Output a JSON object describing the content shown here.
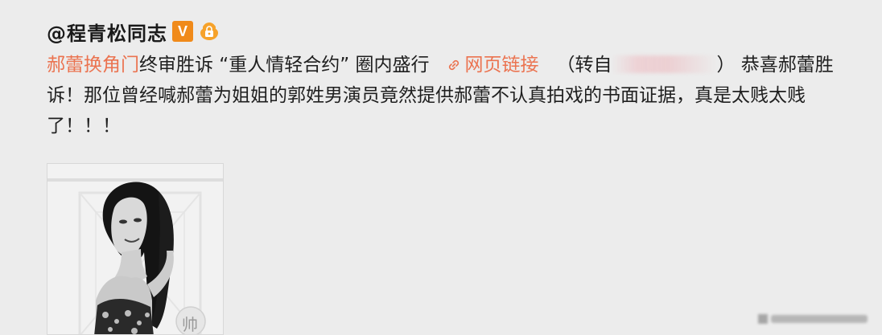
{
  "user": {
    "name": "@程青松同志",
    "vip_badge": "V",
    "vip_color": "#f08a1a",
    "level_icon": "lock-badge-icon"
  },
  "post": {
    "topic_link": "郝蕾换角门",
    "text_1": "终审胜诉 “重人情轻合约” 圈内盛行",
    "web_link_icon": "link-icon",
    "web_link_label": "网页链接",
    "repost_prefix": "（转自",
    "repost_suffix": "） 恭喜郝蕾胜诉！那位曾经喊郝蕾为姐姐的郭姓男演员竟然提供郝蕾不认真拍戏的书面证据，真是太贱太贱了！！！",
    "link_color": "#eb7350"
  },
  "photo": {
    "corner_mark": "帅"
  }
}
